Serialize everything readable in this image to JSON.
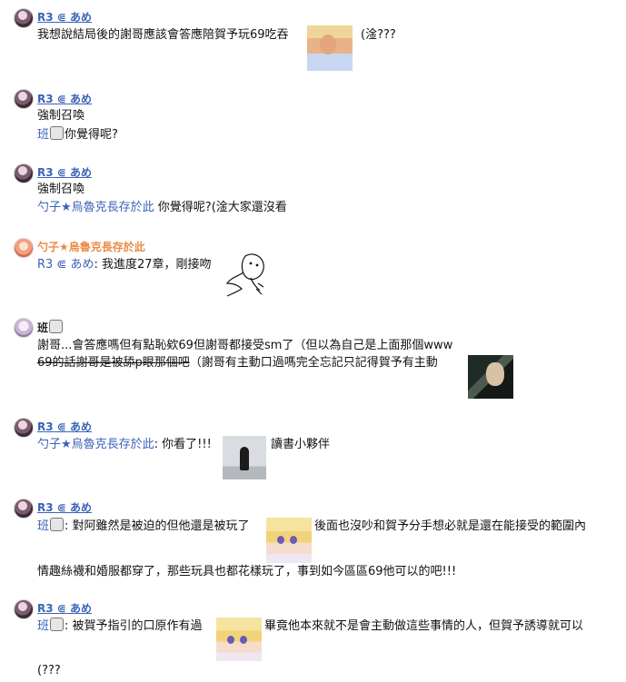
{
  "messages": [
    {
      "author": "R3 ⋐ あめ",
      "lines": [
        "我想說結局後的謝哥應該會答應陪賀予玩69吃吞",
        "(淦???"
      ]
    },
    {
      "author": "R3 ⋐ あめ",
      "lines": [
        "強制召喚",
        "班",
        "你覺得呢?"
      ]
    },
    {
      "author": "R3 ⋐ あめ",
      "lines": [
        "強制召喚",
        "勺子★烏魯克長存於此",
        " 你覺得呢?(淦大家還沒看"
      ]
    },
    {
      "author": "勺子★烏魯克長存於此",
      "lines": [
        "R3 ⋐ あめ",
        ": 我進度27章，剛接吻"
      ]
    },
    {
      "author": "班",
      "lines": [
        "謝哥...會答應嗎但有點恥欸69但謝哥都接受sm了（但以為自己是上面那個www",
        "69的話謝哥是被舔p眼那個吧",
        "（謝哥有主動口過嗎完全忘記只記得賀予有主動"
      ]
    },
    {
      "author": "R3 ⋐ あめ",
      "lines": [
        "勺子★烏魯克長存於此",
        ": 你看了!!!",
        "讀書小夥伴"
      ]
    },
    {
      "author": "R3 ⋐ あめ",
      "lines": [
        "班",
        ": 對阿雖然是被迫的但他還是被玩了",
        "後面也沒吵和賀予分手想必就是還在能接受的範圍內",
        "情趣絲襪和婚服都穿了，那些玩具也都花樣玩了，事到如今區區69他可以的吧!!!"
      ]
    },
    {
      "author": "R3 ⋐ あめ",
      "lines": [
        "班",
        ": 被賀予指引的口原作有過",
        "畢竟他本來就不是會主動做這些事情的人，但賀予誘導就可以",
        "(???"
      ]
    }
  ]
}
